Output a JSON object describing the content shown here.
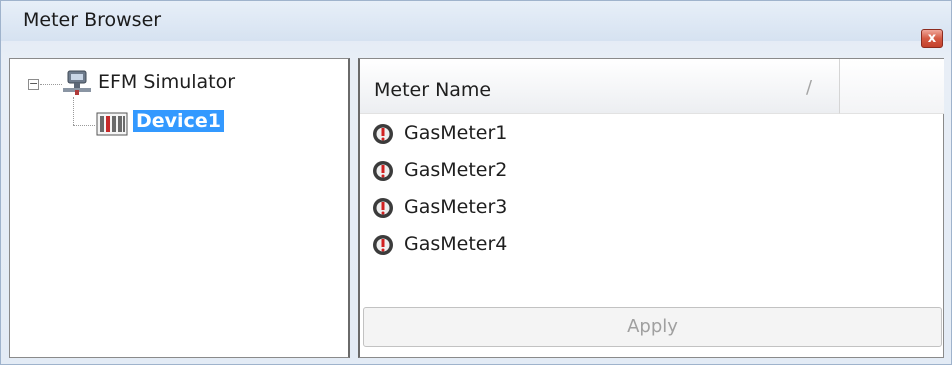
{
  "window": {
    "title": "Meter Browser",
    "close_glyph": "x"
  },
  "tree": {
    "root": {
      "label": "EFM Simulator",
      "icon": "network-server-icon",
      "expander": "−"
    },
    "child": {
      "label": "Device1",
      "icon": "device-icon",
      "selected": true
    }
  },
  "list": {
    "column_header": "Meter Name",
    "sort_indicator": "/",
    "rows": [
      {
        "label": "GasMeter1",
        "icon": "meter-icon"
      },
      {
        "label": "GasMeter2",
        "icon": "meter-icon"
      },
      {
        "label": "GasMeter3",
        "icon": "meter-icon"
      },
      {
        "label": "GasMeter4",
        "icon": "meter-icon"
      }
    ],
    "apply_label": "Apply"
  },
  "colors": {
    "selection": "#3399ff",
    "meter_red": "#d11f1f"
  }
}
